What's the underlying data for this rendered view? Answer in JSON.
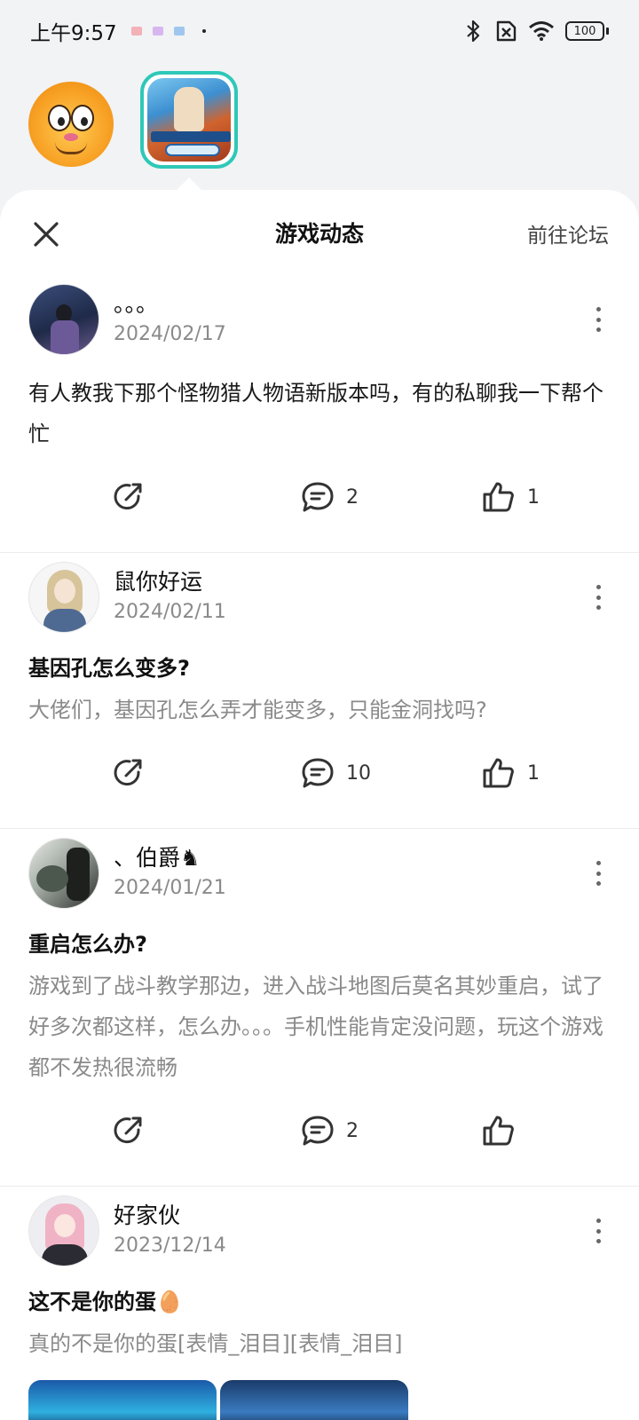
{
  "status_bar": {
    "time": "上午9:57",
    "battery": "100"
  },
  "sheet": {
    "title": "游戏动态",
    "forum_link": "前往论坛"
  },
  "posts": [
    {
      "username": "。。。",
      "date": "2024/02/17",
      "title": "",
      "body": "有人教我下那个怪物猎人物语新版本吗，有的私聊我一下帮个忙",
      "comments": "2",
      "likes": "1"
    },
    {
      "username": "鼠你好运",
      "date": "2024/02/11",
      "title": "基因孔怎么变多?",
      "body": "大佬们，基因孔怎么弄才能变多，只能金洞找吗?",
      "comments": "10",
      "likes": "1"
    },
    {
      "username": "、伯爵♞",
      "date": "2024/01/21",
      "title": "重启怎么办?",
      "body": "游戏到了战斗教学那边，进入战斗地图后莫名其妙重启，试了好多次都这样，怎么办。。。手机性能肯定没问题，玩这个游戏都不发热很流畅",
      "comments": "2",
      "likes": ""
    },
    {
      "username": "好家伙",
      "date": "2023/12/14",
      "title": "这不是你的蛋🥚",
      "body": "真的不是你的蛋[表情_泪目][表情_泪目]",
      "comments": "",
      "likes": ""
    }
  ],
  "colors": {
    "accent_border": "#2ec8b8",
    "secondary_text": "#8a8a8a"
  }
}
